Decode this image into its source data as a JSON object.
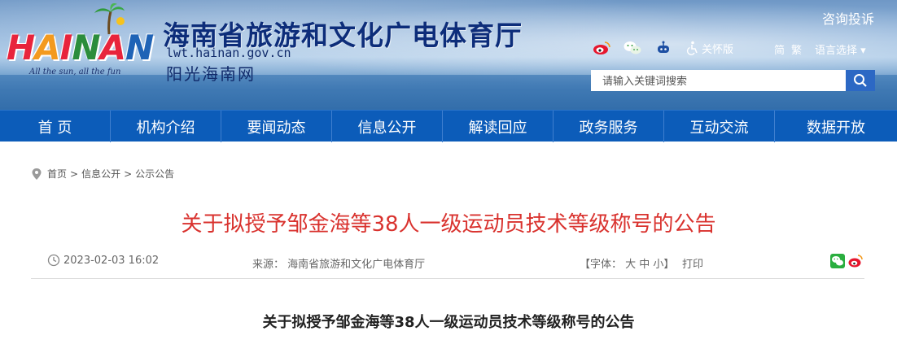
{
  "header": {
    "logo_text": "HAINAN",
    "logo_slogan": "All the sun, all the fun",
    "site_title": "海南省旅游和文化广电体育厅",
    "site_domain": "lwt.hainan.gov.cn",
    "site_subtitle": "阳光海南网",
    "complain_label": "咨询投诉",
    "care_label": "关怀版",
    "lang_simplified": "简",
    "lang_traditional": "繁",
    "lang_select": "语言选择 ▾",
    "search_placeholder": "请输入关键词搜索"
  },
  "nav": {
    "items": [
      "首 页",
      "机构介绍",
      "要闻动态",
      "信息公开",
      "解读回应",
      "政务服务",
      "互动交流",
      "数据开放"
    ]
  },
  "breadcrumb": {
    "items": [
      "首页",
      "信息公开",
      "公示公告"
    ],
    "separator": ">"
  },
  "article": {
    "title": "关于拟授予邹金海等38人一级运动员技术等级称号的公告",
    "date": "2023-02-03 16:02",
    "source": "来源： 海南省旅游和文化广电体育厅",
    "font_size": "【字体： 大 中 小】",
    "print": "打印",
    "body_heading": "关于拟授予邹金海等38人一级运动员技术等级称号的公告"
  },
  "colors": {
    "nav_bg": "#0c5cb9",
    "title_red": "#d9322e",
    "site_title": "#0d2d7a",
    "search_button": "#2c68c4"
  }
}
